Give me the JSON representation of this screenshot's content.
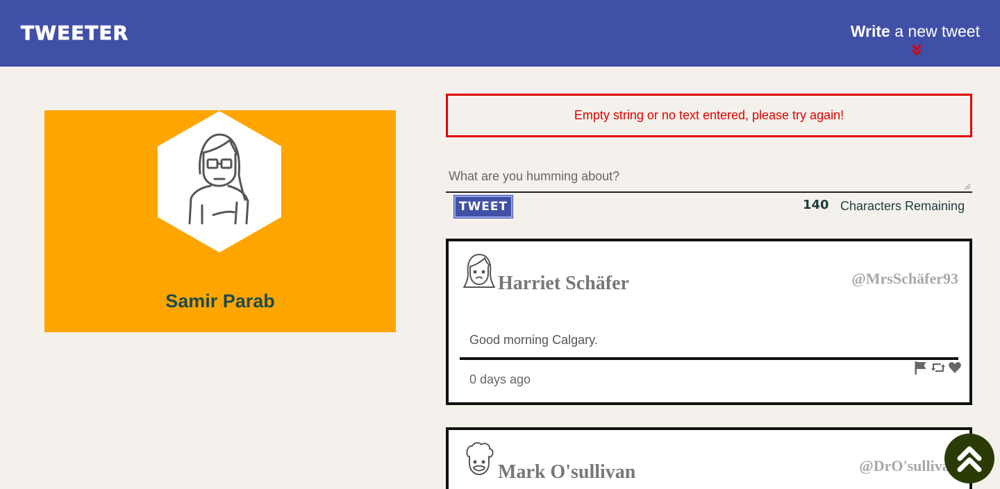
{
  "header": {
    "brand": "TWEETER",
    "write_bold": "Write",
    "write_rest": "a new tweet",
    "accent_color": "#e00000",
    "background": "#4150a7"
  },
  "profile": {
    "name": "Samir Parab",
    "background": "#ffa500"
  },
  "compose": {
    "error_message": "Empty string or no text entered, please try again!",
    "placeholder": "What are you humming about?",
    "button_label": "TWEET",
    "chars_remaining": "140",
    "chars_label": "Characters Remaining"
  },
  "tweets": [
    {
      "author": "Harriet Schäfer",
      "handle": "@MrsSchäfer93",
      "text": "Good morning Calgary.",
      "timestamp": "0 days ago",
      "icons": [
        "flag-icon",
        "retweet-icon",
        "heart-icon"
      ]
    },
    {
      "author": "Mark O'sullivan",
      "handle": "@DrO'sullivan"
    }
  ]
}
